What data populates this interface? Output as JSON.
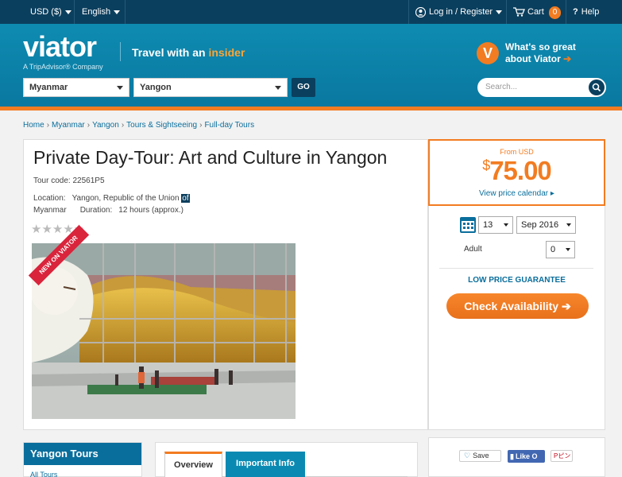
{
  "topbar": {
    "currency": "USD ($)",
    "language": "English",
    "login": "Log in / Register",
    "cart": "Cart",
    "cart_count": "0",
    "help": "Help"
  },
  "header": {
    "logo": "viator",
    "logo_sub": "A TripAdvisor® Company",
    "tagline_start": "Travel with an ",
    "tagline_highlight": "insider",
    "country": "Myanmar",
    "city": "Yangon",
    "go": "GO",
    "whats_line1": "What's so great",
    "whats_line2": "about Viator",
    "whats_arrow": "➔",
    "search_placeholder": "Search...",
    "badge_letter": "V"
  },
  "breadcrumb": [
    "Home",
    "Myanmar",
    "Yangon",
    "Tours & Sightseeing",
    "Full-day Tours"
  ],
  "tour": {
    "title": "Private Day-Tour: Art and Culture in Yangon",
    "code_label": "Tour code:",
    "code": "22561P5",
    "location_label": "Location:",
    "location_value": "Yangon, Republic of the Union",
    "location_highlight": "of",
    "location_value2": "Myanmar",
    "duration_label": "Duration:",
    "duration_value": "12 hours (approx.)",
    "rating_stars": "★★★★★",
    "ribbon": "NEW ON VIATOR"
  },
  "pricing": {
    "from": "From USD",
    "currency_symbol": "$",
    "amount": "75.00",
    "view_calendar": "View price calendar ▸",
    "day": "13",
    "month_year": "Sep 2016",
    "adult_label": "Adult",
    "adult_count": "0",
    "low_price": "LOW PRICE GUARANTEE",
    "check_availability": "Check Availability ➔"
  },
  "sidebar": {
    "heading": "Yangon Tours",
    "link": "All Tours"
  },
  "tabs": [
    "Overview",
    "Important Info"
  ],
  "social": {
    "save": "Save",
    "like": "Like O",
    "pin": "Pピン"
  },
  "colors": {
    "navy": "#0b3f5e",
    "teal": "#0a8ab3",
    "orange": "#f27c21",
    "ribbon_red": "#d9243c"
  }
}
